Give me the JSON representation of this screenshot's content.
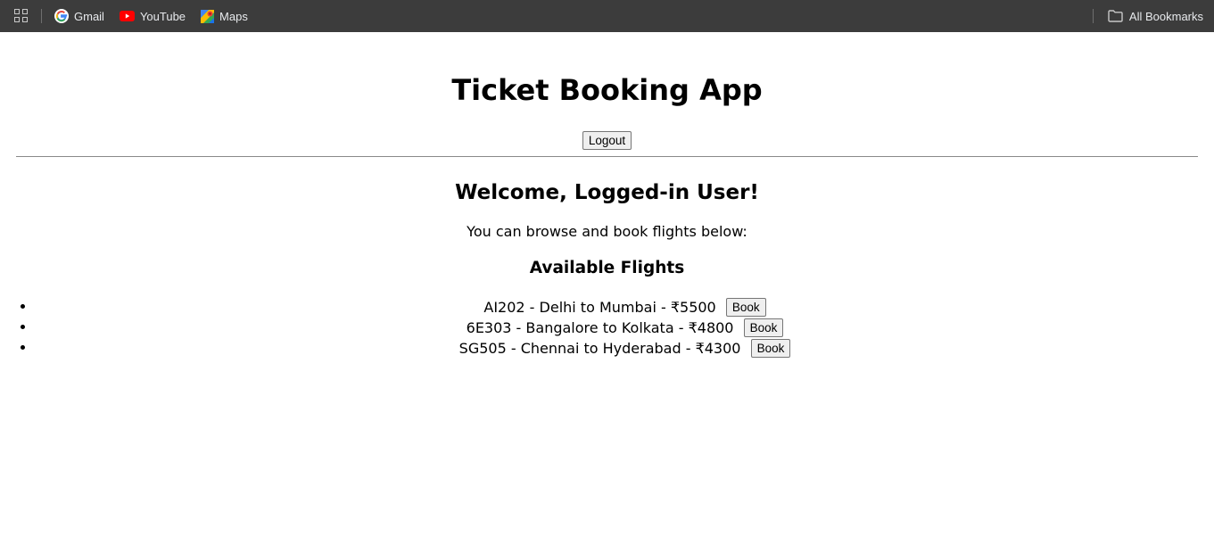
{
  "bookmarks_bar": {
    "items": [
      {
        "label": "Gmail",
        "icon": "google-icon"
      },
      {
        "label": "YouTube",
        "icon": "youtube-icon"
      },
      {
        "label": "Maps",
        "icon": "maps-icon"
      }
    ],
    "all_bookmarks_label": "All Bookmarks"
  },
  "app": {
    "title": "Ticket Booking App",
    "logout_label": "Logout"
  },
  "main": {
    "welcome": "Welcome, Logged-in User!",
    "intro": "You can browse and book flights below:",
    "flights_heading": "Available Flights",
    "flights": [
      {
        "text": "AI202 - Delhi to Mumbai - ₹5500",
        "book_label": "Book"
      },
      {
        "text": "6E303 - Bangalore to Kolkata - ₹4800",
        "book_label": "Book"
      },
      {
        "text": "SG505 - Chennai to Hyderabad - ₹4300",
        "book_label": "Book"
      }
    ]
  },
  "colors": {
    "bookmarks_bar_bg": "#3c3c3c",
    "button_bg": "#efefef",
    "youtube_red": "#ff0000"
  }
}
